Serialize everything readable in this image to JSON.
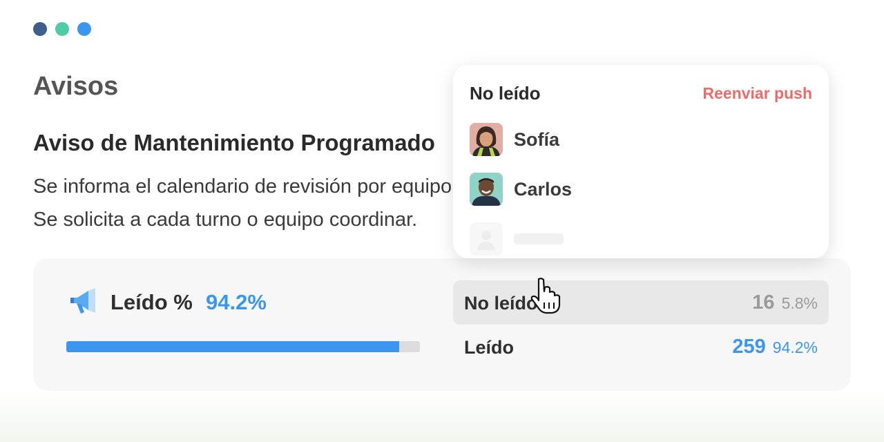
{
  "window_dots": [
    "#3d5f8a",
    "#4fcca5",
    "#3b96ef"
  ],
  "page": {
    "title": "Avisos"
  },
  "notice": {
    "title": "Aviso de Mantenimiento Programado",
    "lines": [
      "Se informa el calendario de revisión por equipo.",
      "Se solicita a cada turno o equipo coordinar."
    ]
  },
  "stats": {
    "icon": "megaphone-icon",
    "read_label": "Leído %",
    "read_value": "94.2%",
    "progress_fraction": 0.942,
    "rows": [
      {
        "label": "No leído",
        "count": "16",
        "percent": "5.8%",
        "count_color": "#9a9a9a",
        "percent_color": "#9a9a9a"
      },
      {
        "label": "Leído",
        "count": "259",
        "percent": "94.2%",
        "count_color": "#3b96ef",
        "percent_color": "#3b96ef"
      }
    ]
  },
  "popup": {
    "title": "No leído",
    "action_label": "Reenviar push",
    "people": [
      {
        "name": "Sofía",
        "avatar": "avatar-sofia"
      },
      {
        "name": "Carlos",
        "avatar": "avatar-carlos"
      }
    ]
  },
  "colors": {
    "accent": "#3b96ef",
    "action": "#f06a6a"
  }
}
